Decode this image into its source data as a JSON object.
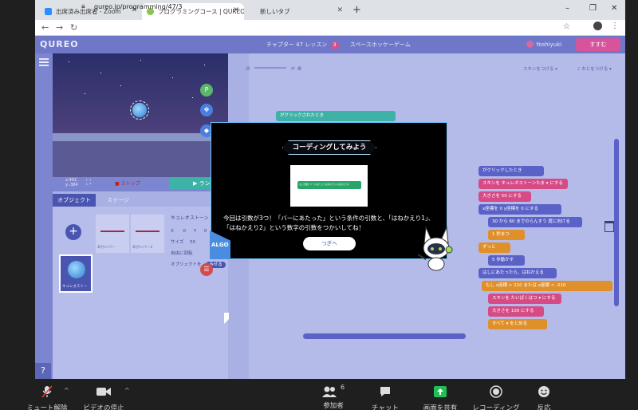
{
  "browser": {
    "tabs": [
      {
        "label": "出席済み出席者 - Zoom",
        "active": false
      },
      {
        "label": "プログラミングコース | QUREO(キュレオ)",
        "active": true
      },
      {
        "label": "新しいタブ",
        "active": false
      }
    ],
    "new_tab_label": "+",
    "url": "qureo.jp/programming/47/3",
    "window_controls": [
      "–",
      "❐",
      "✕"
    ]
  },
  "app": {
    "logo": "QUREO",
    "lesson_prefix": "チャプター 47 レッスン",
    "lesson_number": "3",
    "lesson_name": "スペースホッケーゲーム",
    "user_name": "Yoshiyuki",
    "next_button": "すすむ",
    "stage_coords": [
      "x:402",
      "y:-384"
    ],
    "stop_label": "ストップ",
    "run_label": "ラン",
    "object_tabs": [
      "オブジェクト",
      "ステージ"
    ],
    "assets": [
      "あかいバー",
      "あかいバー2"
    ],
    "character_label": "キュレオストー",
    "properties": {
      "name": "キュレオストーン",
      "x_label": "X",
      "x_value": "0",
      "y_label": "Y",
      "y_value": "0",
      "size_label": "サイズ",
      "size_value": "50",
      "rotation_label": "自由に回転",
      "visible_label": "オブジェクトを",
      "visible_value": "みせる"
    },
    "workspace": {
      "zoom_minus": "⊖",
      "zoom_reset": "=",
      "zoom_plus": "⊕",
      "skin_label": "スキンをつける ▾",
      "sound_label": "♪ おとをつける ▾"
    },
    "code_blocks": [
      {
        "text": "がクリックしたとき",
        "color": "#5b62c7"
      },
      {
        "text": "スキンを キュレオストーンたま ▾ にする",
        "color": "#d64a86"
      },
      {
        "text": "大きさを 50 にする",
        "color": "#d64a86"
      },
      {
        "text": "x座標を 0 y座標を 0 にする",
        "color": "#5b62c7"
      },
      {
        "text": "30 から 60 までのらんすう 度に向ける",
        "color": "#5b62c7"
      },
      {
        "text": "1 秒まつ",
        "color": "#e0902a"
      },
      {
        "text": "ずっと",
        "color": "#e0902a"
      },
      {
        "text": "5 歩動かす",
        "color": "#5b62c7"
      },
      {
        "text": "はしにあたったら、はねかえる",
        "color": "#5b62c7"
      },
      {
        "text": "もし x座標 > 210 または x座標 < -210",
        "color": "#e0902a"
      },
      {
        "text": "スキンを たいばくはつ ▾ にする",
        "color": "#d64a86"
      },
      {
        "text": "大きさを 100 にする",
        "color": "#d64a86"
      },
      {
        "text": "すべて ▾ をとめる",
        "color": "#e0902a"
      }
    ],
    "top_block": "がクリックされたとき",
    "help_label": "?"
  },
  "modal": {
    "title": "コーディングしてみよう",
    "image_block_text": "もし引数が バーにあたった はねかえり1 はねかえり2",
    "body": "今回は引数が3つ！「バーにあたった」という条件の引数と、「はねかえり1」、「はねかえり2」という数字の引数をつかいしてね！",
    "ok_button": "つぎへ",
    "algo_label": "ALGO"
  },
  "zoom_bar": {
    "items": [
      {
        "label": "ミュート解除",
        "icon": "mic-muted-icon"
      },
      {
        "label": "ビデオの停止",
        "icon": "video-icon"
      },
      {
        "label": "参加者",
        "icon": "participants-icon",
        "count": "6"
      },
      {
        "label": "チャット",
        "icon": "chat-icon"
      },
      {
        "label": "画面を共有",
        "icon": "share-screen-icon"
      },
      {
        "label": "レコーディング",
        "icon": "record-icon"
      },
      {
        "label": "反応",
        "icon": "reaction-icon"
      }
    ],
    "share_color": "#1dbf56"
  }
}
